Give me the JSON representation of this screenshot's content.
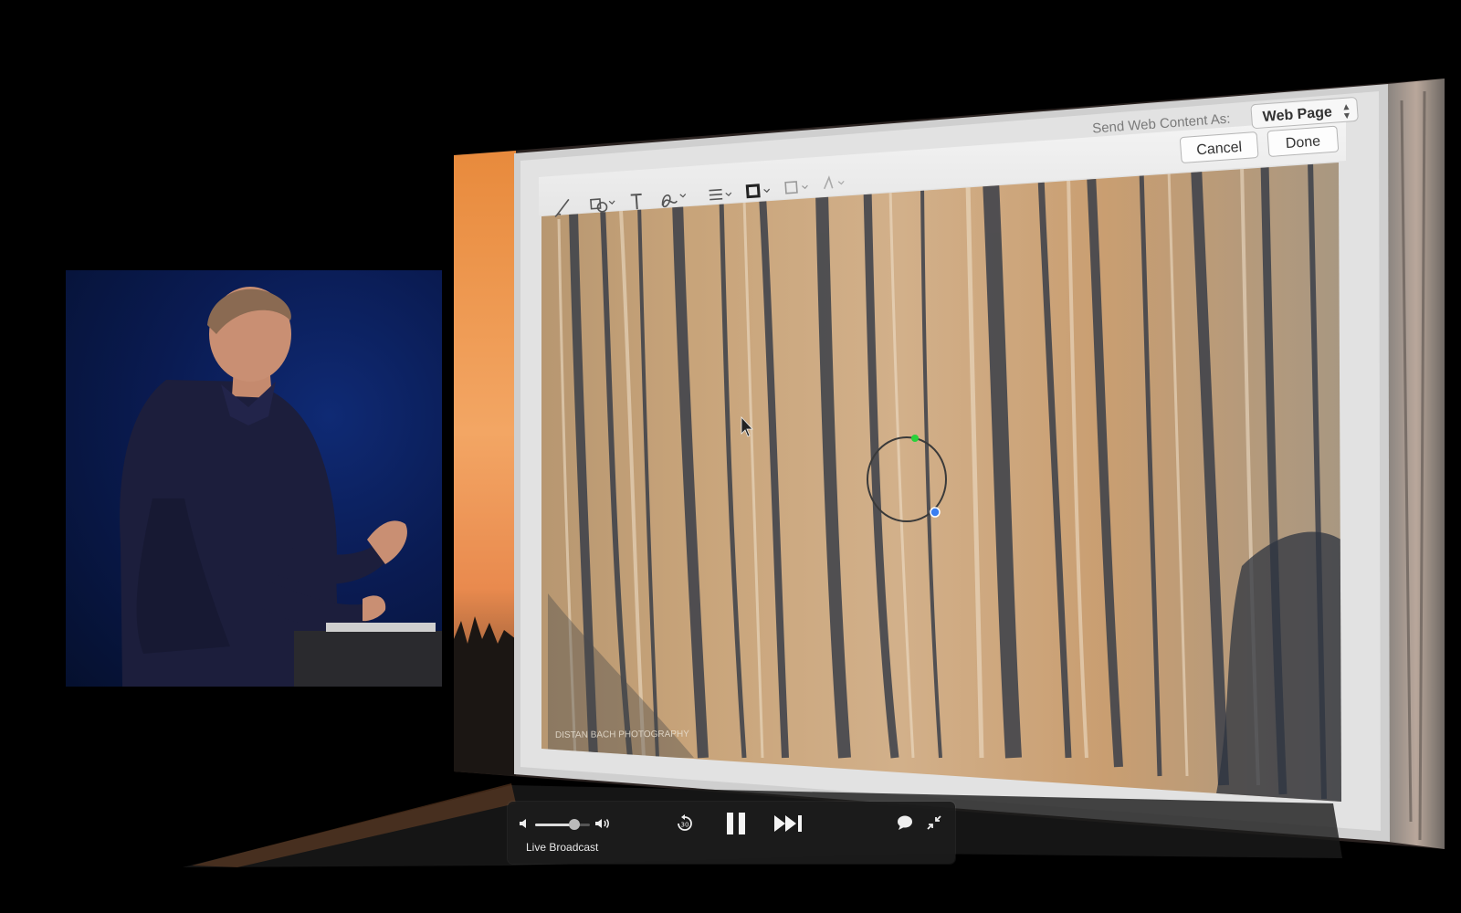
{
  "dialog": {
    "send_as_label": "Send Web Content As:",
    "send_as_value": "Web Page",
    "cancel_label": "Cancel",
    "done_label": "Done",
    "watermark": "DISTAN BACH PHOTOGRAPHY"
  },
  "toolbar": {
    "icons": [
      "sketch-icon",
      "shapes-icon",
      "text-icon",
      "signature-icon",
      "line-style-icon",
      "border-color-icon",
      "fill-color-icon",
      "font-icon"
    ]
  },
  "player": {
    "live_label": "Live Broadcast",
    "volume_fraction": 0.72,
    "icons": [
      "speaker-low-icon",
      "speaker-high-icon",
      "rewind-30-icon",
      "pause-icon",
      "skip-forward-icon",
      "chat-icon",
      "exit-fullscreen-icon"
    ]
  },
  "colors": {
    "rock_light": "#c8a47a",
    "rock_dark": "#3a3f49",
    "stage_blue": "#0a1b52",
    "annotation_green": "#29d23a",
    "annotation_blue": "#3a7ef0"
  }
}
